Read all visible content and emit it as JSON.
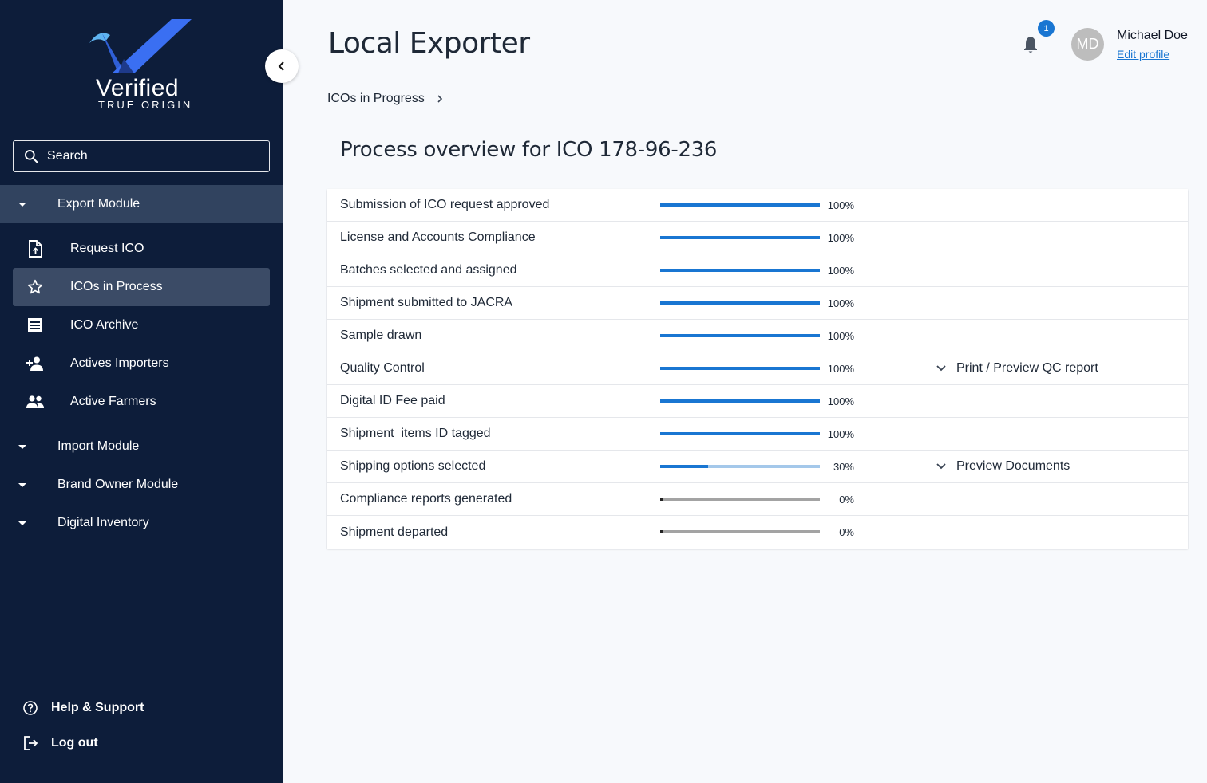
{
  "brand": {
    "word": "Verified",
    "sub": "TRUE ORIGIN",
    "colors": {
      "sidebar": "#0d1d3a",
      "accent": "#1976d2",
      "logo_blue": "#2f5fd6",
      "logo_light": "#5fb4f0"
    }
  },
  "sidebar": {
    "search": {
      "placeholder": "Search",
      "icon": "search-icon"
    },
    "modules": [
      {
        "label": "Export Module",
        "expanded": true
      },
      {
        "label": "Import Module",
        "expanded": false
      },
      {
        "label": "Brand Owner Module",
        "expanded": false
      },
      {
        "label": "Digital Inventory",
        "expanded": false
      }
    ],
    "items": [
      {
        "label": "Request ICO",
        "icon": "file-upload-icon"
      },
      {
        "label": "ICOs in Process",
        "icon": "star-icon",
        "active": true
      },
      {
        "label": "ICO Archive",
        "icon": "receipt-icon"
      },
      {
        "label": "Actives Importers",
        "icon": "person-add-icon"
      },
      {
        "label": "Active Farmers",
        "icon": "people-icon"
      }
    ],
    "help": "Help & Support",
    "logout": "Log out"
  },
  "header": {
    "title": "Local Exporter",
    "notifications": 1,
    "notifications_label": "1",
    "user": {
      "initials": "MD",
      "name": "Michael Doe",
      "edit": "Edit profile"
    }
  },
  "breadcrumb": {
    "label": "ICOs in Progress"
  },
  "main": {
    "title": "Process overview for ICO 178-96-236",
    "steps": [
      {
        "label": "Submission of ICO request approved",
        "progress": 100,
        "pct": "100%"
      },
      {
        "label": "License and Accounts Compliance",
        "progress": 100,
        "pct": "100%"
      },
      {
        "label": "Batches selected and assigned",
        "progress": 100,
        "pct": "100%"
      },
      {
        "label": "Shipment submitted to JACRA",
        "progress": 100,
        "pct": "100%"
      },
      {
        "label": "Sample drawn",
        "progress": 100,
        "pct": "100%"
      },
      {
        "label": "Quality Control",
        "progress": 100,
        "pct": "100%",
        "action": "Print / Preview QC report"
      },
      {
        "label": "Digital ID Fee paid",
        "progress": 100,
        "pct": "100%"
      },
      {
        "label": "Shipment  items ID tagged",
        "progress": 100,
        "pct": "100%"
      },
      {
        "label": "Shipping options selected",
        "progress": 30,
        "pct": "30%",
        "action": "Preview Documents"
      },
      {
        "label": "Compliance reports generated",
        "progress": 0,
        "pct": "0%"
      },
      {
        "label": "Shipment departed",
        "progress": 0,
        "pct": "0%"
      }
    ]
  }
}
